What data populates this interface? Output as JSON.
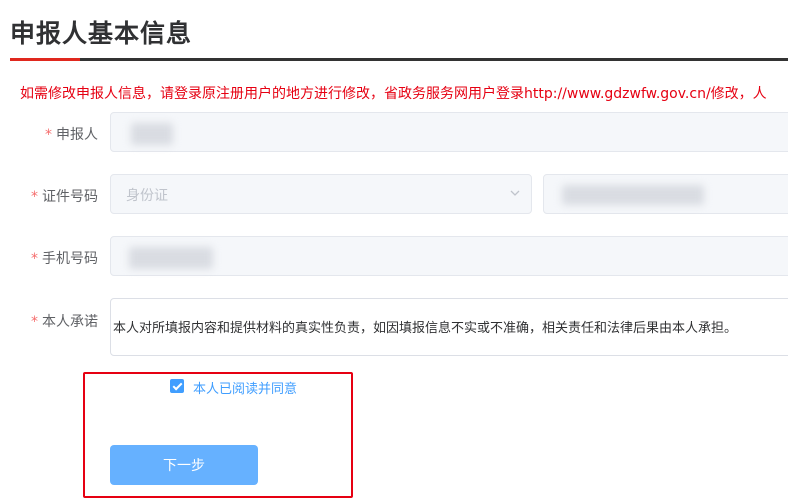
{
  "header": {
    "title": "申报人基本信息"
  },
  "notice": "如需修改申报人信息，请登录原注册用户的地方进行修改，省政务服务网用户登录http://www.gdzwfw.gov.cn/修改，人",
  "form": {
    "required_mark": "*",
    "applicant": {
      "label": "申报人",
      "value": ""
    },
    "id_number": {
      "label": "证件号码",
      "id_type": "身份证",
      "value": ""
    },
    "phone": {
      "label": "手机号码",
      "value": ""
    },
    "promise": {
      "label": "本人承诺",
      "text": "本人对所填报内容和提供材料的真实性负责，如因填报信息不实或不准确，相关责任和法律后果由本人承担。"
    }
  },
  "agreement": {
    "checked": true,
    "label": "本人已阅读并同意"
  },
  "actions": {
    "next_label": "下一步"
  },
  "colors": {
    "accent_red": "#e0281e",
    "warning_red": "#e60012",
    "primary_blue": "#409eff",
    "button_blue": "#66b1ff"
  },
  "icons": {
    "select_arrow": "chevron-down-icon",
    "checkbox": "checkmark-icon"
  }
}
